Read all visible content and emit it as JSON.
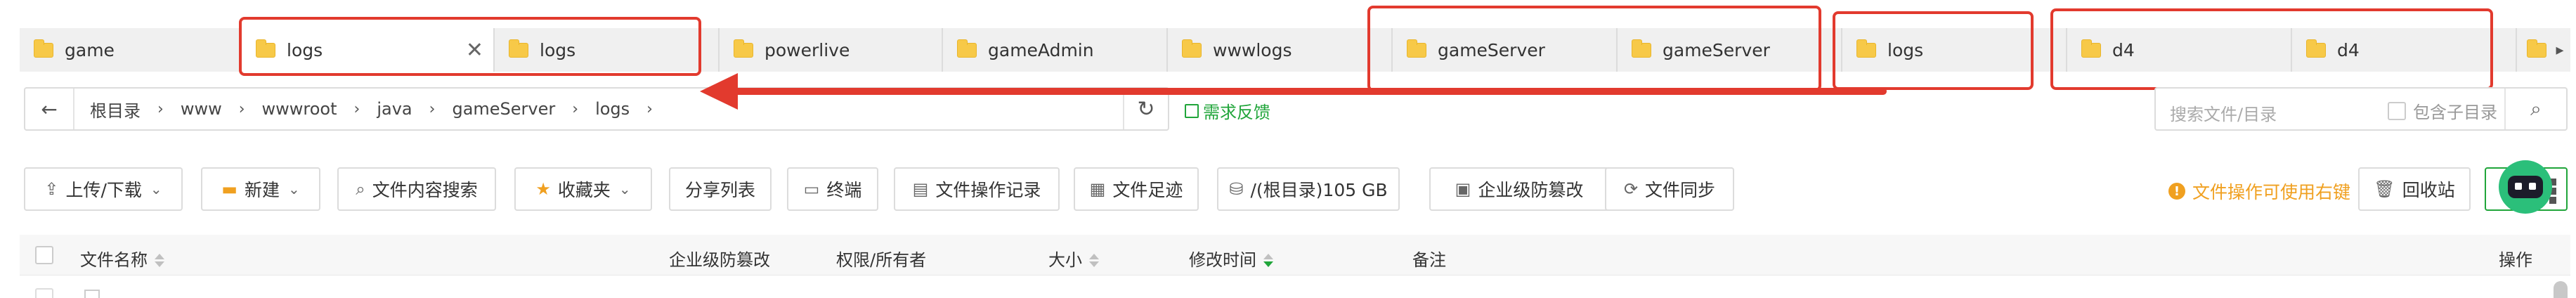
{
  "tabs": [
    {
      "label": "game",
      "active": false
    },
    {
      "label": "logs",
      "active": true,
      "closable": true
    },
    {
      "label": "logs",
      "active": false
    },
    {
      "label": "powerlive",
      "active": false
    },
    {
      "label": "gameAdmin",
      "active": false
    },
    {
      "label": "wwwlogs",
      "active": false
    },
    {
      "label": "gameServer",
      "active": false
    },
    {
      "label": "gameServer",
      "active": false
    },
    {
      "label": "logs",
      "active": false
    },
    {
      "label": "d4",
      "active": false
    },
    {
      "label": "d4",
      "active": false
    }
  ],
  "tabbar": {
    "close_icon": "✕",
    "next_icon": "▸"
  },
  "breadcrumb": {
    "back_icon": "←",
    "items": [
      "根目录",
      "www",
      "wwwroot",
      "java",
      "gameServer",
      "logs"
    ],
    "separator": "›",
    "refresh_icon": "↻"
  },
  "feedback": {
    "label": "需求反馈"
  },
  "search": {
    "placeholder": "搜索文件/目录",
    "subdir_label": "包含子目录",
    "search_icon": "⌕"
  },
  "toolbar": {
    "upload_download": "上传/下载",
    "new": "新建",
    "content_search": "文件内容搜索",
    "favorites": "收藏夹",
    "share_list": "分享列表",
    "terminal": "终端",
    "operation_log": "文件操作记录",
    "file_footprint": "文件足迹",
    "disk": "/(根目录)105 GB",
    "tamper_proof": "企业级防篡改",
    "file_sync": "文件同步",
    "tip": "文件操作可使用右键",
    "recycle": "回收站"
  },
  "table": {
    "columns": {
      "name": "文件名称",
      "tamper": "企业级防篡改",
      "permission": "权限/所有者",
      "size": "大小",
      "mtime": "修改时间",
      "remark": "备注",
      "actions": "操作"
    },
    "sort": {
      "column": "mtime",
      "direction": "desc"
    }
  },
  "colors": {
    "accent": "#20a53a",
    "annotation": "#e23a2e",
    "warning": "#f0a020",
    "folder": "#f7c948"
  }
}
